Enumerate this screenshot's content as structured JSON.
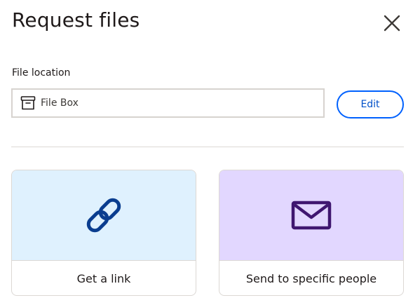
{
  "dialog": {
    "title": "Request files",
    "close_icon": "close-icon"
  },
  "file_location": {
    "label": "File location",
    "value": "File Box",
    "icon": "archive-box-icon",
    "edit_label": "Edit"
  },
  "options": [
    {
      "label": "Get a link",
      "icon": "link-icon",
      "art_background": "#dff1fe",
      "icon_color": "#0a3d8f"
    },
    {
      "label": "Send to specific people",
      "icon": "envelope-icon",
      "art_background": "#e2d7ff",
      "icon_color": "#3f1670"
    }
  ],
  "colors": {
    "accent": "#0061fe",
    "text": "#1e1919",
    "border": "#d7d3cf"
  }
}
